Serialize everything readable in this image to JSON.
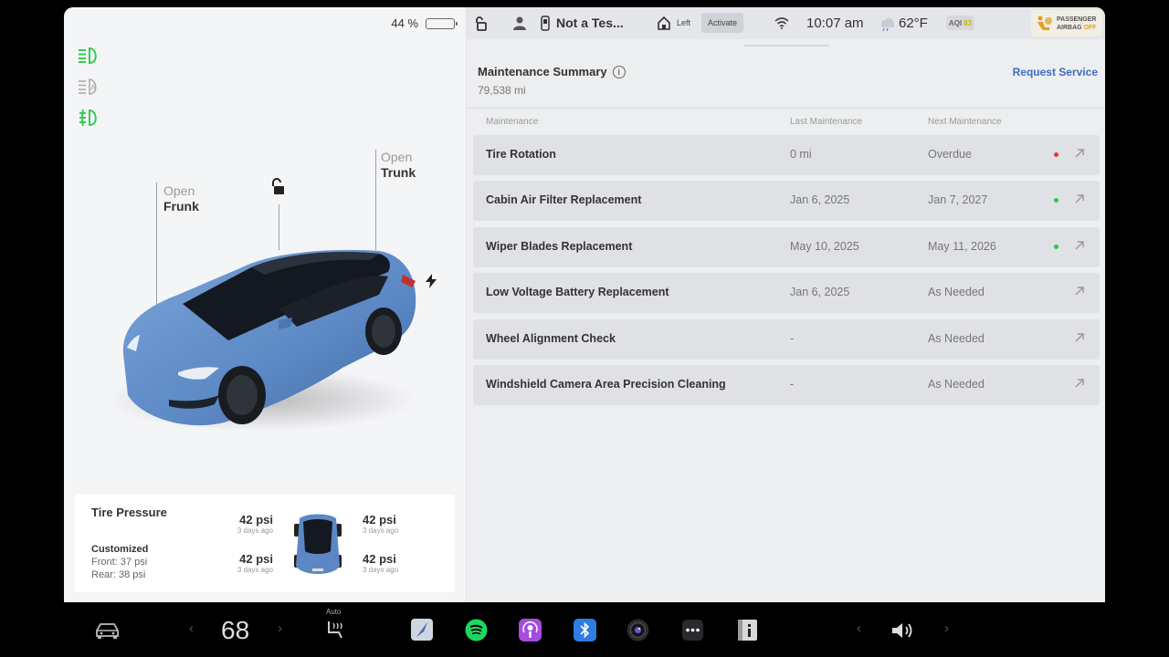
{
  "status": {
    "battery_percent": "44 %",
    "battery_level": 0.44,
    "profile_name": "Not a Tes...",
    "homelink_label": "Left",
    "activate_label": "Activate",
    "time": "10:07 am",
    "temperature": "62°F",
    "aqi_label": "AQI",
    "aqi_value": "83",
    "airbag_line1": "PASSENGER",
    "airbag_line2": "AIRBAG",
    "airbag_state": "OFF"
  },
  "car": {
    "frunk_t1": "Open",
    "frunk_t2": "Frunk",
    "trunk_t1": "Open",
    "trunk_t2": "Trunk",
    "body_color": "#5b88c4"
  },
  "tire_pressure": {
    "title": "Tire Pressure",
    "customized_label": "Customized",
    "front": "Front: 37 psi",
    "rear": "Rear: 38 psi",
    "tires": [
      {
        "pressure": "42 psi",
        "age": "3 days ago"
      },
      {
        "pressure": "42 psi",
        "age": "3 days ago"
      },
      {
        "pressure": "42 psi",
        "age": "3 days ago"
      },
      {
        "pressure": "42 psi",
        "age": "3 days ago"
      }
    ]
  },
  "maintenance": {
    "title": "Maintenance Summary",
    "odometer": "79,538  mi",
    "request_service": "Request Service",
    "columns": [
      "Maintenance",
      "Last Maintenance",
      "Next Maintenance"
    ],
    "rows": [
      {
        "name": "Tire Rotation",
        "last": "0 mi",
        "next": "Overdue",
        "status": "red"
      },
      {
        "name": "Cabin Air Filter Replacement",
        "last": "Jan 6, 2025",
        "next": "Jan 7, 2027",
        "status": "green"
      },
      {
        "name": "Wiper Blades Replacement",
        "last": "May 10, 2025",
        "next": "May 11, 2026",
        "status": "green"
      },
      {
        "name": "Low Voltage Battery Replacement",
        "last": "Jan 6, 2025",
        "next": "As Needed",
        "status": "none"
      },
      {
        "name": "Wheel Alignment Check",
        "last": "-",
        "next": "As Needed",
        "status": "none"
      },
      {
        "name": "Windshield Camera Area Precision Cleaning",
        "last": "-",
        "next": "As Needed",
        "status": "none"
      }
    ]
  },
  "colors": {
    "accent_blue": "#3e6cc0",
    "status_red": "#e03b3b",
    "status_green": "#3cbf4a",
    "light_green": "#33cc55"
  },
  "taskbar": {
    "cabin_temp": "68",
    "seat_heat_label": "Auto",
    "apps": [
      "car-icon",
      "navigation-icon",
      "spotify-icon",
      "podcasts-icon",
      "bluetooth-icon",
      "camera-icon",
      "more-apps-icon",
      "manual-icon",
      "volume-icon"
    ]
  }
}
